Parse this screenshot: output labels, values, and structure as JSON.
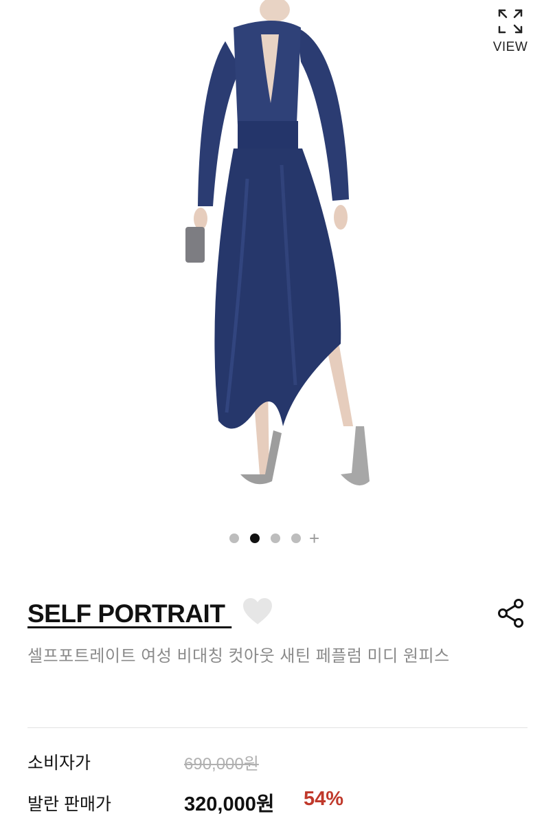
{
  "gallery": {
    "view_label": "VIEW",
    "current_index": 2,
    "total_dots": 4,
    "more_symbol": "+",
    "image_alt": "product-photo-navy-satin-dress"
  },
  "brand": {
    "name": "SELF PORTRAIT "
  },
  "product": {
    "title": "셀프포트레이트 여성 비대칭 컷아웃 새틴 페플럼 미디 원피스"
  },
  "pricing": {
    "consumer_label": "소비자가",
    "consumer_price": "690,000원",
    "sale_label": "발란 판매가",
    "sale_price": "320,000원",
    "discount": "54%"
  },
  "colors": {
    "dress": "#26376b",
    "accent_discount": "#c0392b",
    "dot_active": "#111111",
    "dot_inactive": "#bdbdbd"
  },
  "icons": {
    "view": "expand-icon",
    "wishlist": "heart-icon",
    "share": "share-icon"
  }
}
